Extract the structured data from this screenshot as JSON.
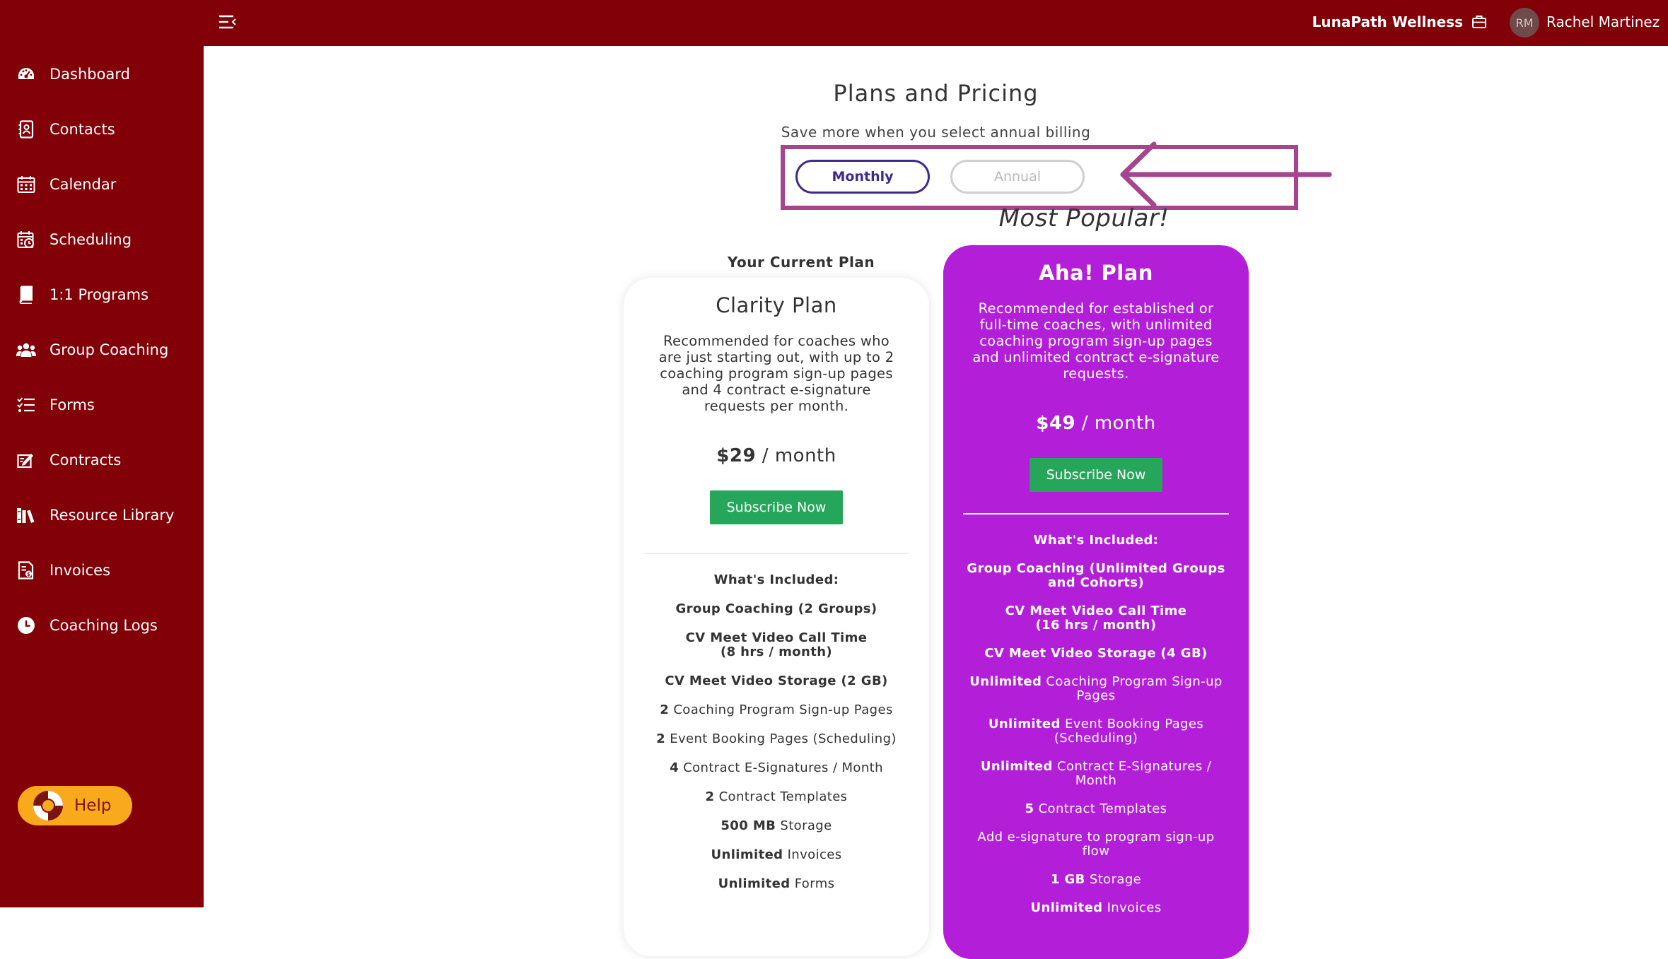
{
  "header": {
    "brand_name": "LunaPath Wellness",
    "avatar_initials": "RM",
    "user_name": "Rachel Martinez"
  },
  "sidebar": {
    "items": [
      {
        "label": "Dashboard",
        "icon": "dashboard-gauge-icon"
      },
      {
        "label": "Contacts",
        "icon": "contacts-book-icon"
      },
      {
        "label": "Calendar",
        "icon": "calendar-icon"
      },
      {
        "label": "Scheduling",
        "icon": "scheduling-calendar-clock-icon"
      },
      {
        "label": "1:1 Programs",
        "icon": "book-icon"
      },
      {
        "label": "Group Coaching",
        "icon": "group-users-icon"
      },
      {
        "label": "Forms",
        "icon": "checklist-icon"
      },
      {
        "label": "Contracts",
        "icon": "contract-pen-icon"
      },
      {
        "label": "Resource Library",
        "icon": "library-books-icon"
      },
      {
        "label": "Invoices",
        "icon": "invoice-icon"
      },
      {
        "label": "Coaching Logs",
        "icon": "clock-icon"
      }
    ],
    "help_label": "Help"
  },
  "main": {
    "title": "Plans and Pricing",
    "subtitle": "Save more when you select annual billing",
    "billing": {
      "monthly_label": "Monthly",
      "annual_label": "Annual",
      "selected": "Monthly"
    },
    "popular_label": "Most Popular!",
    "current_plan_label": "Your Current Plan",
    "plans": [
      {
        "name": "Clarity Plan",
        "description": "Recommended for coaches who are just starting out, with up to 2 coaching program sign-up pages and 4 contract e-signature requests per month.",
        "price": "$29",
        "period": " / month",
        "cta": "Subscribe Now",
        "included_title": "What's Included:",
        "features": [
          {
            "bold": "Group Coaching (2 Groups)",
            "rest": ""
          },
          {
            "bold": "CV Meet Video Call Time\n(8 hrs / month)",
            "rest": ""
          },
          {
            "bold": "CV Meet Video Storage (2 GB)",
            "rest": ""
          },
          {
            "bold": "2",
            "rest": " Coaching Program Sign-up Pages"
          },
          {
            "bold": "2",
            "rest": " Event Booking Pages (Scheduling)"
          },
          {
            "bold": "4",
            "rest": " Contract E-Signatures / Month"
          },
          {
            "bold": "2",
            "rest": " Contract Templates"
          },
          {
            "bold": "500 MB",
            "rest": " Storage"
          },
          {
            "bold": "Unlimited",
            "rest": " Invoices"
          },
          {
            "bold": "Unlimited",
            "rest": " Forms"
          }
        ]
      },
      {
        "name": "Aha! Plan",
        "description": "Recommended for established or full-time coaches, with unlimited coaching program sign-up pages and unlimited contract e-signature requests.",
        "price": "$49",
        "period": " / month",
        "cta": "Subscribe Now",
        "included_title": "What's Included:",
        "features": [
          {
            "bold": "Group Coaching (Unlimited Groups and Cohorts)",
            "rest": ""
          },
          {
            "bold": "CV Meet Video Call Time\n(16 hrs / month)",
            "rest": ""
          },
          {
            "bold": "CV Meet Video Storage (4 GB)",
            "rest": ""
          },
          {
            "bold": "Unlimited",
            "rest": " Coaching Program Sign-up Pages"
          },
          {
            "bold": "Unlimited",
            "rest": " Event Booking Pages (Scheduling)"
          },
          {
            "bold": "Unlimited",
            "rest": " Contract E-Signatures / Month"
          },
          {
            "bold": "5",
            "rest": " Contract Templates"
          },
          {
            "bold": "",
            "rest": "Add e-signature to program sign-up flow"
          },
          {
            "bold": "1 GB",
            "rest": " Storage"
          },
          {
            "bold": "Unlimited",
            "rest": " Invoices"
          }
        ]
      }
    ]
  },
  "colors": {
    "sidebar_bg": "#820008",
    "popular_card_bg": "#b31ed8",
    "subscribe_green": "#26a65b",
    "highlight": "#a64490",
    "help_button": "#f8a91c"
  }
}
